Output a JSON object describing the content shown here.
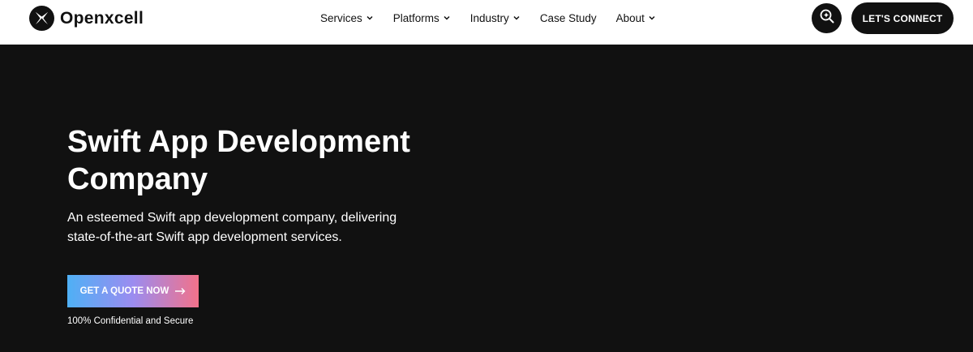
{
  "header": {
    "logo_text": "Openxcell",
    "nav": [
      {
        "label": "Services",
        "has_dropdown": true
      },
      {
        "label": "Platforms",
        "has_dropdown": true
      },
      {
        "label": "Industry",
        "has_dropdown": true
      },
      {
        "label": "Case Study",
        "has_dropdown": false
      },
      {
        "label": "About",
        "has_dropdown": true
      }
    ],
    "search_icon": "search-icon",
    "connect_label": "LET'S CONNECT"
  },
  "hero": {
    "title": "Swift App Development Company",
    "subtitle": "An esteemed Swift app development company, delivering state-of-the-art Swift app development services.",
    "cta_label": "GET A QUOTE NOW",
    "cta_icon": "arrow-right-icon",
    "note": "100% Confidential and Secure"
  },
  "colors": {
    "background": "#111111",
    "header_bg": "#ffffff",
    "cta_gradient_start": "#4fb0f5",
    "cta_gradient_mid": "#9b8cf0",
    "cta_gradient_end": "#f2728a"
  }
}
